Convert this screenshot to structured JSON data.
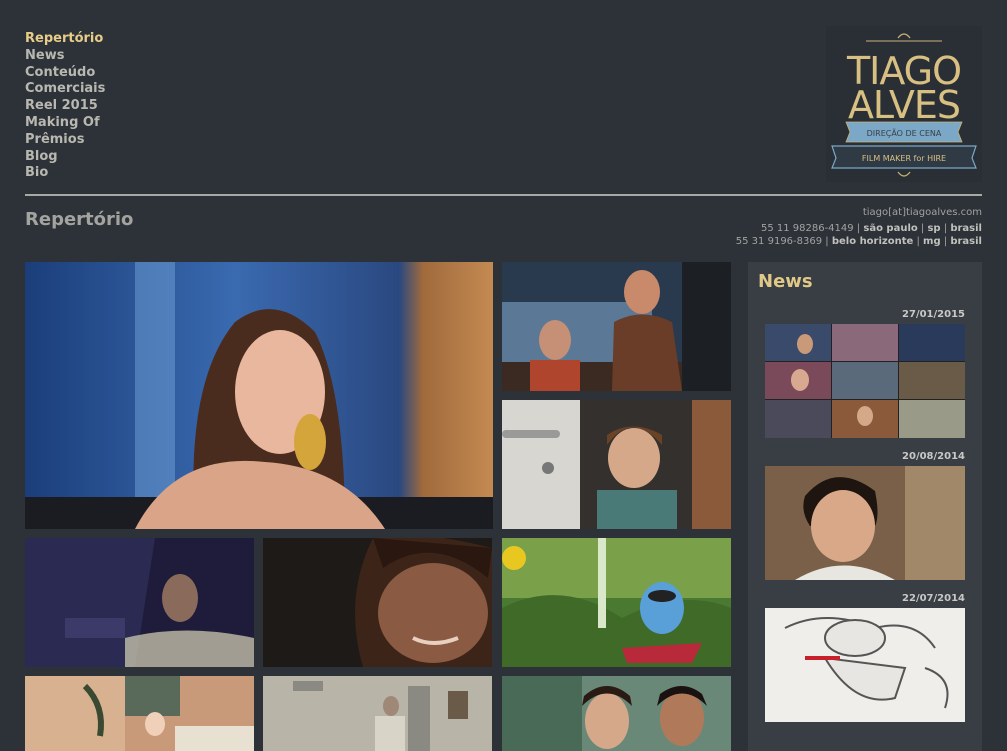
{
  "nav": {
    "items": [
      {
        "label": "Repertório",
        "active": true
      },
      {
        "label": "News"
      },
      {
        "label": "Conteúdo"
      },
      {
        "label": "Comerciais"
      },
      {
        "label": "Reel 2015"
      },
      {
        "label": "Making Of"
      },
      {
        "label": "Prêmios"
      },
      {
        "label": "Blog"
      },
      {
        "label": "Bio"
      }
    ]
  },
  "logo": {
    "line1": "TIAGO",
    "line2": "ALVES",
    "ribbon": "DIREÇÃO DE CENA",
    "tagline": "FILM MAKER for HIRE"
  },
  "page": {
    "title": "Repertório"
  },
  "contact": {
    "email": "tiago[at]tiagoalves.com",
    "phone1": "55 11 98286-4149",
    "city1": "são paulo",
    "state1": "sp",
    "country1": "brasil",
    "phone2": "55 31 9196-8369",
    "city2": "belo horizonte",
    "state2": "mg",
    "country2": "brasil",
    "separator": " | "
  },
  "news": {
    "title": "News",
    "items": [
      {
        "date": "27/01/2015",
        "image": "collage of film stills"
      },
      {
        "date": "20/08/2014",
        "image": "smiling boy"
      },
      {
        "date": "22/07/2014",
        "image": "illustration h2o bottle character"
      }
    ]
  },
  "colors": {
    "background": "#2d3238",
    "accent": "#e8cc8a",
    "nav_text": "#b8b8b0",
    "sidebar": "#393e44"
  }
}
